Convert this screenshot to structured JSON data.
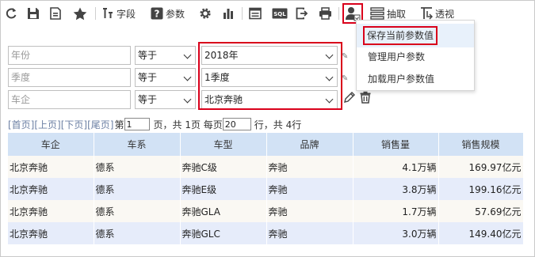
{
  "toolbar": {
    "field_label": "字段",
    "param_label": "参数",
    "extract_label": "抽取",
    "pivot_label": "透视"
  },
  "user_menu": {
    "items": [
      "保存当前参数值",
      "管理用户参数",
      "加载用户参数值"
    ]
  },
  "params": [
    {
      "name_placeholder": "年份",
      "operator": "等于",
      "value": "2018年"
    },
    {
      "name_placeholder": "季度",
      "operator": "等于",
      "value": "1季度"
    },
    {
      "name_placeholder": "车企",
      "operator": "等于",
      "value": "北京奔驰"
    }
  ],
  "pager": {
    "first": "[首页]",
    "prev": "[上页]",
    "next": "[下页]",
    "last": "[尾页]",
    "page_prefix": "第",
    "page_value": "1",
    "page_mid": "页，共 1页 每页",
    "per_page_value": "20",
    "page_suffix": "行，共 4行"
  },
  "table": {
    "headers": [
      "车企",
      "车系",
      "车型",
      "品牌",
      "销售量",
      "销售规模"
    ],
    "rows": [
      [
        "北京奔驰",
        "德系",
        "奔驰C级",
        "奔驰",
        "4.1万辆",
        "169.97亿元"
      ],
      [
        "北京奔驰",
        "德系",
        "奔驰E级",
        "奔驰",
        "3.8万辆",
        "199.16亿元"
      ],
      [
        "北京奔驰",
        "德系",
        "奔驰GLA",
        "奔驰",
        "1.7万辆",
        "57.69亿元"
      ],
      [
        "北京奔驰",
        "德系",
        "奔驰GLC",
        "奔驰",
        "3.0万辆",
        "149.40亿元"
      ]
    ]
  },
  "colors": {
    "highlight_red": "#d9001b",
    "header_bg": "#d2e2f5",
    "row_alt_bg": "#e6ecfa"
  }
}
